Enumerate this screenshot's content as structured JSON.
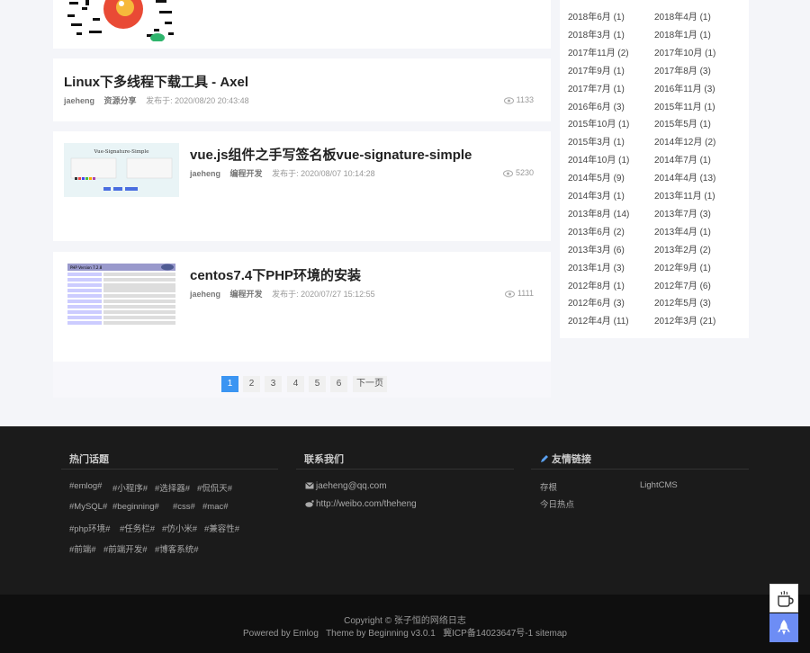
{
  "posts": [
    {
      "title": "Linux下多线程下载工具 - Axel",
      "author": "jaeheng",
      "category": "资源分享",
      "date": "发布于: 2020/08/20 20:43:48",
      "views": "1133"
    },
    {
      "title": "vue.js组件之手写签名板vue-signature-simple",
      "author": "jaeheng",
      "category": "编程开发",
      "date": "发布于: 2020/08/07 10:14:28",
      "views": "5230",
      "thumb_title": "Vue-Signature-Simple"
    },
    {
      "title": "centos7.4下PHP环境的安装",
      "author": "jaeheng",
      "category": "编程开发",
      "date": "发布于: 2020/07/27 15:12:55",
      "views": "1111",
      "thumb_title": "PHP Version 7.2.8"
    }
  ],
  "pagination": {
    "pages": [
      "1",
      "2",
      "3",
      "4",
      "5",
      "6"
    ],
    "next": "下一页",
    "active": "1"
  },
  "archive": [
    [
      "2018年6月 (1)",
      "2018年4月 (1)"
    ],
    [
      "2018年3月 (1)",
      "2018年1月 (1)"
    ],
    [
      "2017年11月 (2)",
      "2017年10月 (1)"
    ],
    [
      "2017年9月 (1)",
      "2017年8月 (3)"
    ],
    [
      "2017年7月 (1)",
      "2016年11月 (3)"
    ],
    [
      "2016年6月 (3)",
      "2015年11月 (1)"
    ],
    [
      "2015年10月 (1)",
      "2015年5月 (1)"
    ],
    [
      "2015年3月 (1)",
      "2014年12月 (2)"
    ],
    [
      "2014年10月 (1)",
      "2014年7月 (1)"
    ],
    [
      "2014年5月 (9)",
      "2014年4月 (13)"
    ],
    [
      "2014年3月 (1)",
      "2013年11月 (1)"
    ],
    [
      "2013年8月 (14)",
      "2013年7月 (3)"
    ],
    [
      "2013年6月 (2)",
      "2013年4月 (1)"
    ],
    [
      "2013年3月 (6)",
      "2013年2月 (2)"
    ],
    [
      "2013年1月 (3)",
      "2012年9月 (1)"
    ],
    [
      "2012年8月 (1)",
      "2012年7月 (6)"
    ],
    [
      "2012年6月 (3)",
      "2012年5月 (3)"
    ],
    [
      "2012年4月 (11)",
      "2012年3月 (21)"
    ]
  ],
  "footer": {
    "hot_title": "热门话题",
    "tags": [
      [
        "#emlog#",
        "#小程序#",
        "#选择器#",
        "#侃侃天#"
      ],
      [
        "#MySQL#",
        "#beginning#",
        "#css#",
        "#mac#"
      ],
      [
        "#php环境#",
        "#任务栏#",
        "#仿小米#",
        "#兼容性#"
      ],
      [
        "#前端#",
        "#前端开发#",
        "#博客系统#"
      ]
    ],
    "contact_title": "联系我们",
    "email": "jaeheng@qq.com",
    "weibo": "http://weibo.com/theheng",
    "links_title": "友情链接",
    "links": [
      "存根",
      "LightCMS",
      "今日热点"
    ],
    "copyright": "Copyright © 张子恒的网络日志",
    "powered": "Powered by Emlog   Theme by Beginning v3.0.1   冀ICP备14023647号-1 sitemap"
  },
  "colors": {
    "accent": "#3b95f2",
    "footer_bg": "#1b1b1b",
    "bottom_bg": "#0f0f0f",
    "rocket_btn": "#6d8df5"
  },
  "icons": [
    "eye-icon",
    "mail-icon",
    "weibo-icon",
    "pencil-icon",
    "coffee-icon",
    "rocket-icon"
  ]
}
